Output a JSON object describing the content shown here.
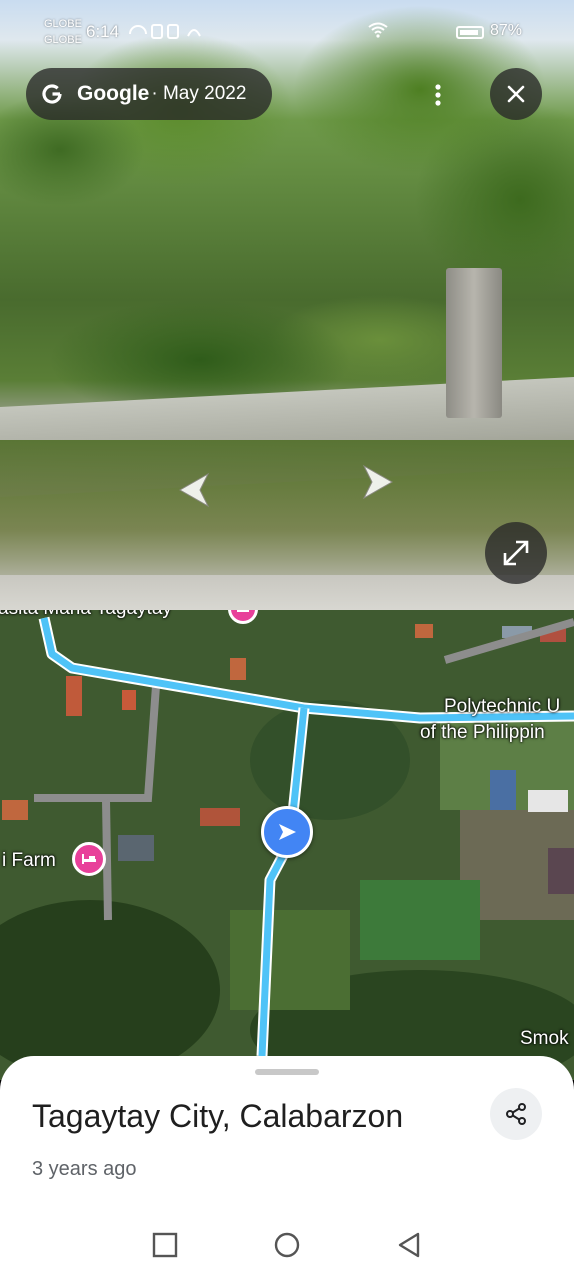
{
  "status_bar": {
    "carrier_1": "GLOBE",
    "carrier_2": "GLOBE",
    "time": "6:14",
    "battery": "87%"
  },
  "streetview": {
    "brand": "Google",
    "date": "· May 2022"
  },
  "map": {
    "labels": {
      "top_partial": "asita Maria Tagaytay",
      "polytechnic_line1": "Polytechnic U",
      "polytechnic_line2": "of the Philippin",
      "farm": "i Farm",
      "smoke": "Smok"
    },
    "route_color": "#4fc3f7",
    "marker_color": "#4285f4",
    "pin_color": "#e8409a"
  },
  "sheet": {
    "title": "Tagaytay City, Calabarzon",
    "subtitle": "3 years ago"
  },
  "icons": {
    "google": "google-g-icon",
    "more": "more-vert-icon",
    "close": "close-icon",
    "share": "share-icon",
    "expand": "expand-icon",
    "hotel": "hotel-icon"
  }
}
